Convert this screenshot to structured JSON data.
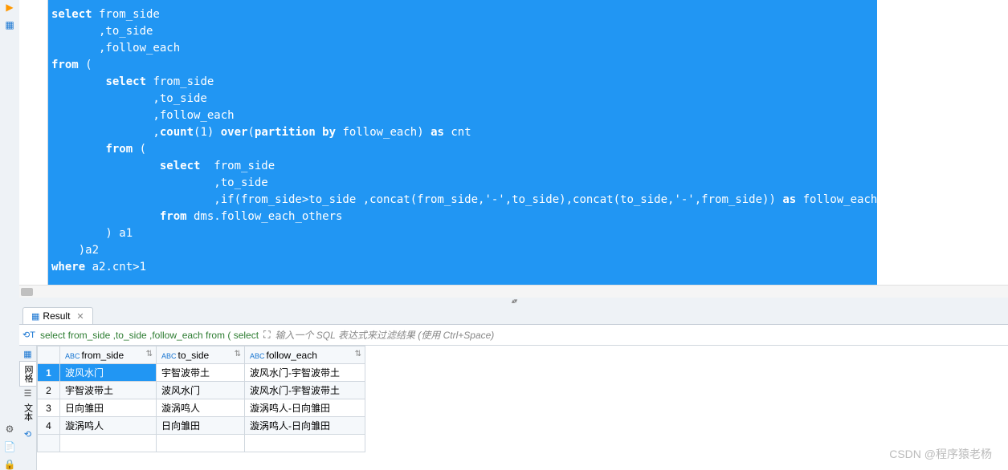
{
  "editor": {
    "code_html": "<span class='kw'>select</span> from_side\n       ,to_side\n       ,follow_each\n<span class='kw'>from</span> (\n        <span class='kw'>select</span> from_side\n               ,to_side\n               ,follow_each\n               ,<span class='kw'>count</span>(1) <span class='kw'>over</span>(<span class='kw'>partition by</span> follow_each) <span class='kw'>as</span> cnt\n        <span class='kw'>from</span> (\n                <span class='kw'>select</span>  from_side\n                        ,to_side\n                        ,if(from_side>to_side ,concat(from_side,'-',to_side),concat(to_side,'-',from_side)) <span class='kw'>as</span> follow_each\n                <span class='kw'>from</span> dms.follow_each_others\n        ) a1\n    )a2\n<span class='kw'>where</span> a2.cnt>1"
  },
  "result": {
    "tab_label": "Result",
    "filter_sql": "select from_side ,to_side ,follow_each from ( select",
    "filter_hint": "输入一个 SQL 表达式来过滤结果 (使用 Ctrl+Space)",
    "columns": [
      "from_side",
      "to_side",
      "follow_each"
    ],
    "col_type_prefix": "ABC",
    "side_tabs": {
      "grid": "网格",
      "text": "文本"
    },
    "rows": [
      {
        "num": "1",
        "from_side": "波风水门",
        "to_side": "宇智波带土",
        "follow_each": "波风水门-宇智波带土",
        "selected": true
      },
      {
        "num": "2",
        "from_side": "宇智波带土",
        "to_side": "波风水门",
        "follow_each": "波风水门-宇智波带土"
      },
      {
        "num": "3",
        "from_side": "日向雏田",
        "to_side": "漩涡鸣人",
        "follow_each": "漩涡鸣人-日向雏田"
      },
      {
        "num": "4",
        "from_side": "漩涡鸣人",
        "to_side": "日向雏田",
        "follow_each": "漩涡鸣人-日向雏田"
      }
    ]
  },
  "watermark": "CSDN @程序猿老杨",
  "chart_data": {
    "type": "table",
    "columns": [
      "from_side",
      "to_side",
      "follow_each"
    ],
    "rows": [
      [
        "波风水门",
        "宇智波带土",
        "波风水门-宇智波带土"
      ],
      [
        "宇智波带土",
        "波风水门",
        "波风水门-宇智波带土"
      ],
      [
        "日向雏田",
        "漩涡鸣人",
        "漩涡鸣人-日向雏田"
      ],
      [
        "漩涡鸣人",
        "日向雏田",
        "漩涡鸣人-日向雏田"
      ]
    ]
  }
}
